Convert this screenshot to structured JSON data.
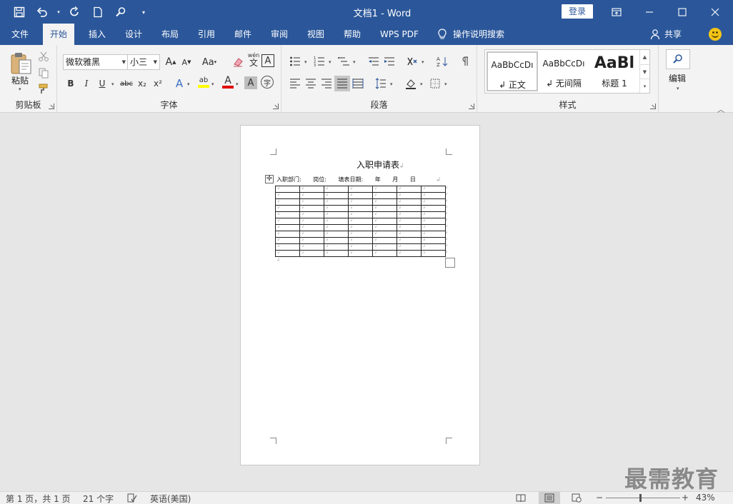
{
  "window": {
    "title": "文档1  -  Word",
    "login_label": "登录"
  },
  "tabs": [
    "文件",
    "开始",
    "插入",
    "设计",
    "布局",
    "引用",
    "邮件",
    "审阅",
    "视图",
    "帮助",
    "WPS PDF"
  ],
  "active_tab": "开始",
  "tell_me": "操作说明搜索",
  "share": "共享",
  "ribbon": {
    "clipboard": {
      "paste_label": "粘贴",
      "group_label": "剪贴板"
    },
    "font": {
      "font_name": "微软雅黑",
      "font_size": "小三",
      "group_label": "字体",
      "grow": "A",
      "shrink": "A",
      "change_case": "Aa",
      "bold": "B",
      "italic": "I",
      "underline": "U",
      "strike": "abc",
      "subscript": "x₂",
      "superscript": "x²",
      "phonetic": "wén",
      "phonetic_char": "文",
      "border_char": "A",
      "effect": "A",
      "highlight": "ab",
      "font_color": "A",
      "shade_char": "A",
      "enclose_char": "字"
    },
    "paragraph": {
      "group_label": "段落"
    },
    "styles": {
      "group_label": "样式",
      "items": [
        {
          "sample": "AaBbCcDı",
          "name": "↲ 正文"
        },
        {
          "sample": "AaBbCcDı",
          "name": "↲ 无间隔"
        },
        {
          "sample": "AaBl",
          "name": "标题 1"
        }
      ]
    },
    "editing": {
      "label": "编辑"
    }
  },
  "document": {
    "heading": "入职申请表",
    "fields": [
      "入职部门:",
      "岗位:",
      "填表日期:",
      "年",
      "月",
      "日"
    ],
    "table_rows": 11,
    "table_cols": 7,
    "cell_mark": "↲"
  },
  "watermark": "最需教育",
  "status": {
    "page": "第 1 页，共 1 页",
    "words": "21 个字",
    "language": "英语(美国)",
    "zoom": "43%",
    "zoom_minus": "−",
    "zoom_plus": "+"
  },
  "colors": {
    "brand": "#2b579a",
    "highlight": "#ffff00",
    "font_red": "#e00000"
  }
}
